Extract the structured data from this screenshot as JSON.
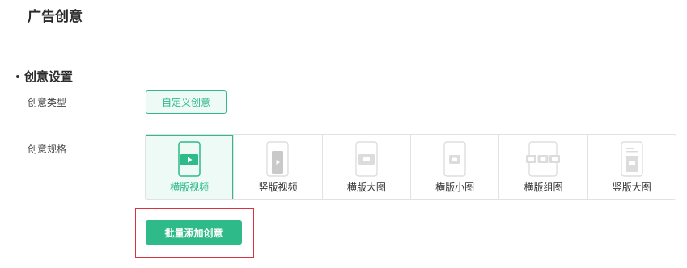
{
  "page": {
    "title": "广告创意"
  },
  "section": {
    "title": "创意设置"
  },
  "creative_type": {
    "label": "创意类型",
    "selected": "自定义创意"
  },
  "creative_spec": {
    "label": "创意规格",
    "options": [
      {
        "label": "横版视频",
        "icon": "landscape-video-icon",
        "selected": true
      },
      {
        "label": "竖版视频",
        "icon": "portrait-video-icon",
        "selected": false
      },
      {
        "label": "横版大图",
        "icon": "landscape-large-image-icon",
        "selected": false
      },
      {
        "label": "横版小图",
        "icon": "landscape-small-image-icon",
        "selected": false
      },
      {
        "label": "横版组图",
        "icon": "landscape-image-group-icon",
        "selected": false
      },
      {
        "label": "竖版大图",
        "icon": "portrait-large-image-icon",
        "selected": false
      }
    ]
  },
  "actions": {
    "batch_add": "批量添加创意"
  },
  "colors": {
    "accent": "#2fba8a",
    "highlight_border": "#d9333f"
  }
}
